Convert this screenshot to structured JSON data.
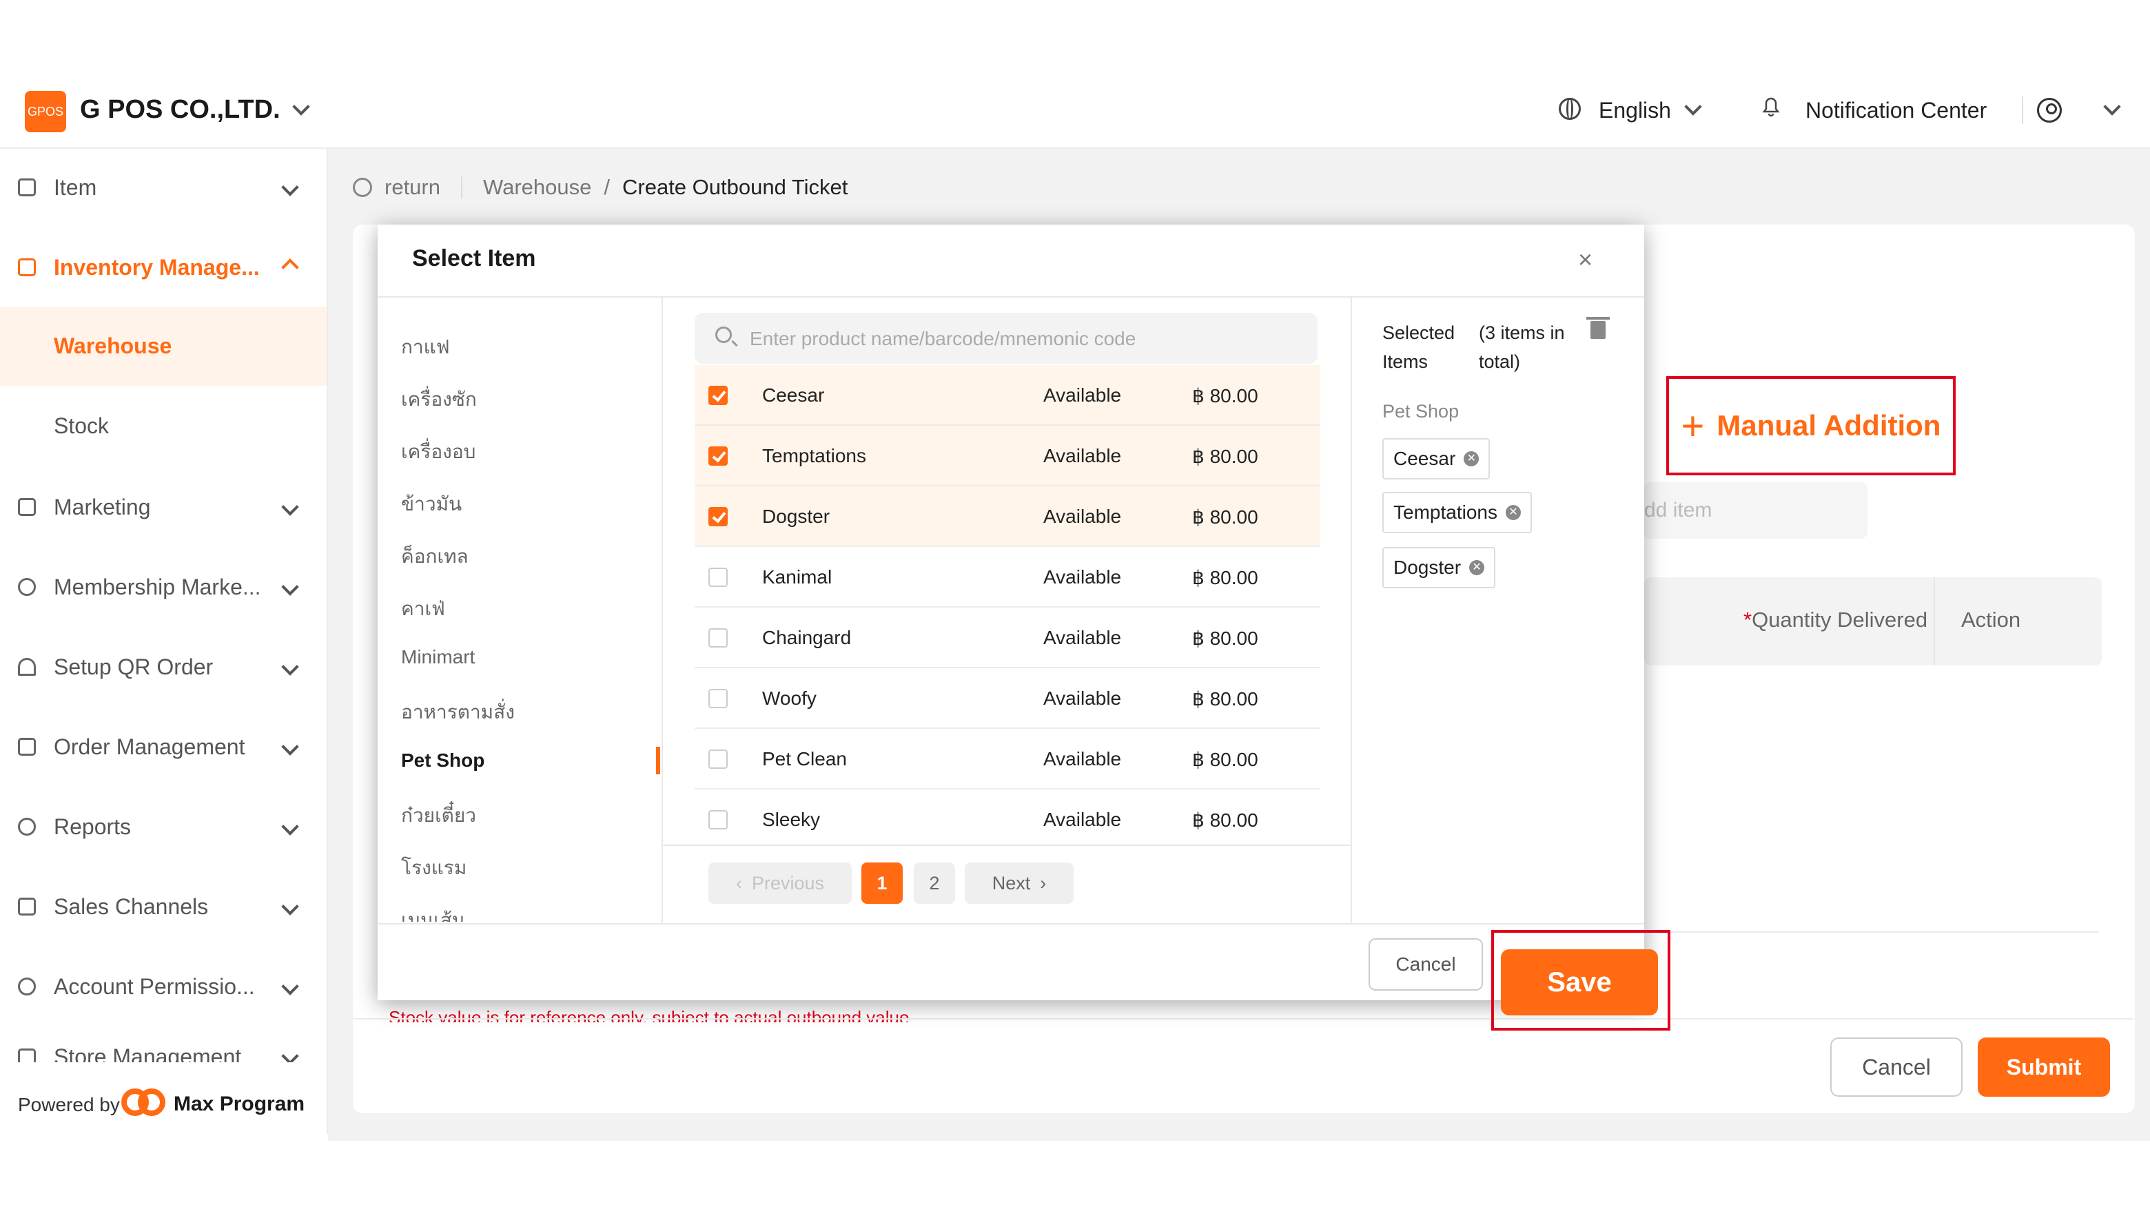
{
  "header": {
    "logo_text": "GPOS",
    "company": "G POS CO.,LTD.",
    "language": "English",
    "notification": "Notification Center"
  },
  "sidebar": {
    "items": [
      {
        "label": "Item"
      },
      {
        "label": "Inventory Manage..."
      },
      {
        "label": "Warehouse"
      },
      {
        "label": "Stock"
      },
      {
        "label": "Marketing"
      },
      {
        "label": "Membership Marke..."
      },
      {
        "label": "Setup QR Order"
      },
      {
        "label": "Order Management"
      },
      {
        "label": "Reports"
      },
      {
        "label": "Sales Channels"
      },
      {
        "label": "Account Permissio..."
      },
      {
        "label": "Store Management"
      }
    ],
    "powered_by": "Powered by",
    "brand": "Max Program"
  },
  "breadcrumb": {
    "return": "return",
    "parent": "Warehouse",
    "separator": "/",
    "current": "Create Outbound Ticket"
  },
  "page": {
    "manual_addition": "Manual Addition",
    "add_item_placeholder": "dd item",
    "col_quantity_required_mark": "*",
    "col_quantity": "Quantity Delivered",
    "col_action": "Action",
    "warning": "Stock value is for reference only, subject to actual outbound value",
    "cancel": "Cancel",
    "submit": "Submit"
  },
  "modal": {
    "title": "Select Item",
    "close": "×",
    "categories": [
      "กาแฟ",
      "เครื่องซัก",
      "เครื่องอบ",
      "ข้าวมัน",
      "ค็อกเทล",
      "คาเฟ่",
      "Minimart",
      "อาหารตามสั่ง",
      "Pet Shop",
      "ก๋วยเตี๋ยว",
      "โรงแรม",
      "เมนเส้น"
    ],
    "active_category": "Pet Shop",
    "search_placeholder": "Enter product name/barcode/mnemonic code",
    "products": [
      {
        "name": "Ceesar",
        "status": "Available",
        "price": "฿ 80.00",
        "checked": true
      },
      {
        "name": "Temptations",
        "status": "Available",
        "price": "฿ 80.00",
        "checked": true
      },
      {
        "name": "Dogster",
        "status": "Available",
        "price": "฿ 80.00",
        "checked": true
      },
      {
        "name": "Kanimal",
        "status": "Available",
        "price": "฿ 80.00",
        "checked": false
      },
      {
        "name": "Chaingard",
        "status": "Available",
        "price": "฿ 80.00",
        "checked": false
      },
      {
        "name": "Woofy",
        "status": "Available",
        "price": "฿ 80.00",
        "checked": false
      },
      {
        "name": "Pet Clean",
        "status": "Available",
        "price": "฿ 80.00",
        "checked": false
      },
      {
        "name": "Sleeky",
        "status": "Available",
        "price": "฿ 80.00",
        "checked": false
      }
    ],
    "pager": {
      "previous": "Previous",
      "page1": "1",
      "page2": "2",
      "next": "Next"
    },
    "selected_label": "Selected Items",
    "selected_total": "(3 items in total)",
    "selected_group": "Pet Shop",
    "selected_tags": [
      "Ceesar",
      "Temptations",
      "Dogster"
    ],
    "cancel": "Cancel",
    "save": "Save"
  },
  "colors": {
    "accent": "#ff6a13",
    "highlight_outline": "#e0001b",
    "selected_row": "#fff5ea"
  }
}
